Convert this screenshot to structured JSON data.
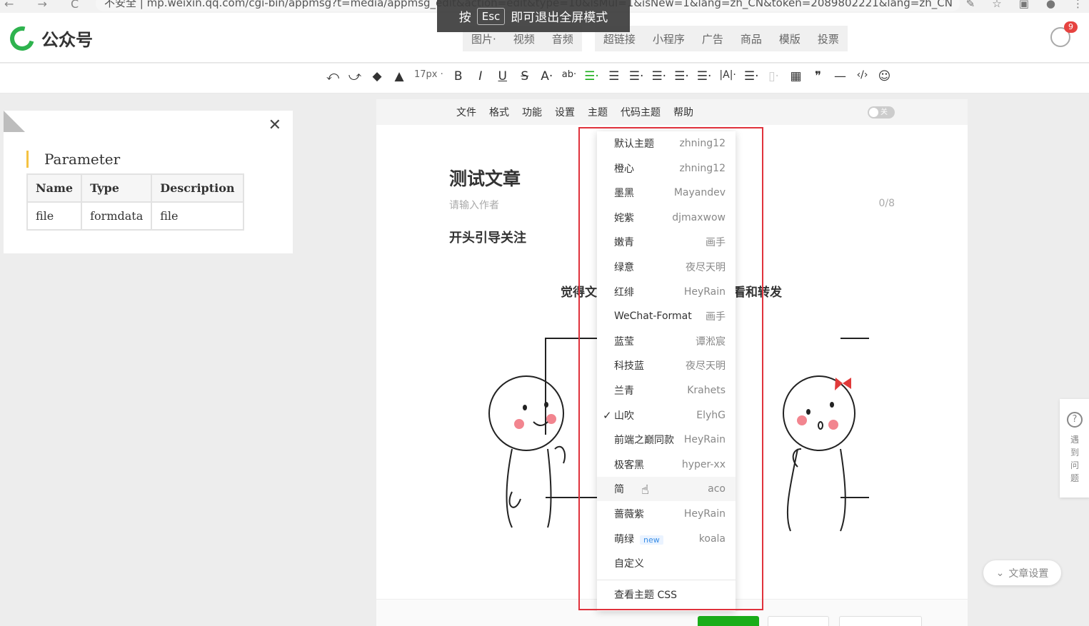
{
  "browser": {
    "url": "不安全 | mp.weixin.qq.com/cgi-bin/appmsg?t=media/appmsg_edit&action=edit&type=10&isMul=1&isNew=1&lang=zh_CN&token=2089802221&lang=zh_CN",
    "fullscreen_hint_pre": "按",
    "fullscreen_hint_key": "Esc",
    "fullscreen_hint_post": "即可退出全屏模式"
  },
  "header": {
    "logo_text": "公众号",
    "insert_tabs_a": [
      "图片·",
      "视频",
      "音频"
    ],
    "insert_tabs_b": [
      "超链接",
      "小程序",
      "广告",
      "商品",
      "模版",
      "投票"
    ],
    "notification_count": "9"
  },
  "toolbar": {
    "font_size": "17px ·",
    "items": [
      "⤺",
      "⤻",
      "◆",
      "▲",
      "B",
      "I",
      "U",
      "S",
      "A·",
      "ab·",
      "☰·",
      "☰",
      "☰·",
      "☰·",
      "☰·",
      "☰·",
      "|A|·",
      "☰·",
      "▯·",
      "▦",
      "❞",
      "—",
      "‹/›",
      "☺"
    ]
  },
  "left_panel": {
    "title": "Parameter",
    "columns": [
      "Name",
      "Type",
      "Description"
    ],
    "rows": [
      [
        "file",
        "formdata",
        "file"
      ]
    ]
  },
  "editor": {
    "menu": [
      "文件",
      "格式",
      "功能",
      "设置",
      "主题",
      "代码主题",
      "帮助"
    ],
    "toggle_label": "关",
    "title": "测试文章",
    "author_placeholder": "请输入作者",
    "author_count": "0/8",
    "lead_text": "开头引导关注",
    "mid_left": "觉得文",
    "mid_right": "看和转发"
  },
  "theme_menu": {
    "items": [
      {
        "name": "默认主题",
        "author": "zhning12"
      },
      {
        "name": "橙心",
        "author": "zhning12"
      },
      {
        "name": "墨黑",
        "author": "Mayandev"
      },
      {
        "name": "姹紫",
        "author": "djmaxwow"
      },
      {
        "name": "嫩青",
        "author": "画手"
      },
      {
        "name": "绿意",
        "author": "夜尽天明"
      },
      {
        "name": "红绯",
        "author": "HeyRain"
      },
      {
        "name": "WeChat-Format",
        "author": "画手"
      },
      {
        "name": "蓝莹",
        "author": "谭淞宸"
      },
      {
        "name": "科技蓝",
        "author": "夜尽天明"
      },
      {
        "name": "兰青",
        "author": "Krahets"
      },
      {
        "name": "山吹",
        "author": "ElyhG",
        "checked": true
      },
      {
        "name": "前端之巅同款",
        "author": "HeyRain"
      },
      {
        "name": "极客黑",
        "author": "hyper-xx"
      },
      {
        "name": "简",
        "author": "aco",
        "hover": true
      },
      {
        "name": "蔷薇紫",
        "author": "HeyRain"
      },
      {
        "name": "萌绿",
        "author": "koala",
        "tag": "new"
      },
      {
        "name": "自定义",
        "author": ""
      }
    ],
    "footer": "查看主题 CSS"
  },
  "side": {
    "help_text": "遇到问题",
    "settings_label": "文章设置"
  }
}
